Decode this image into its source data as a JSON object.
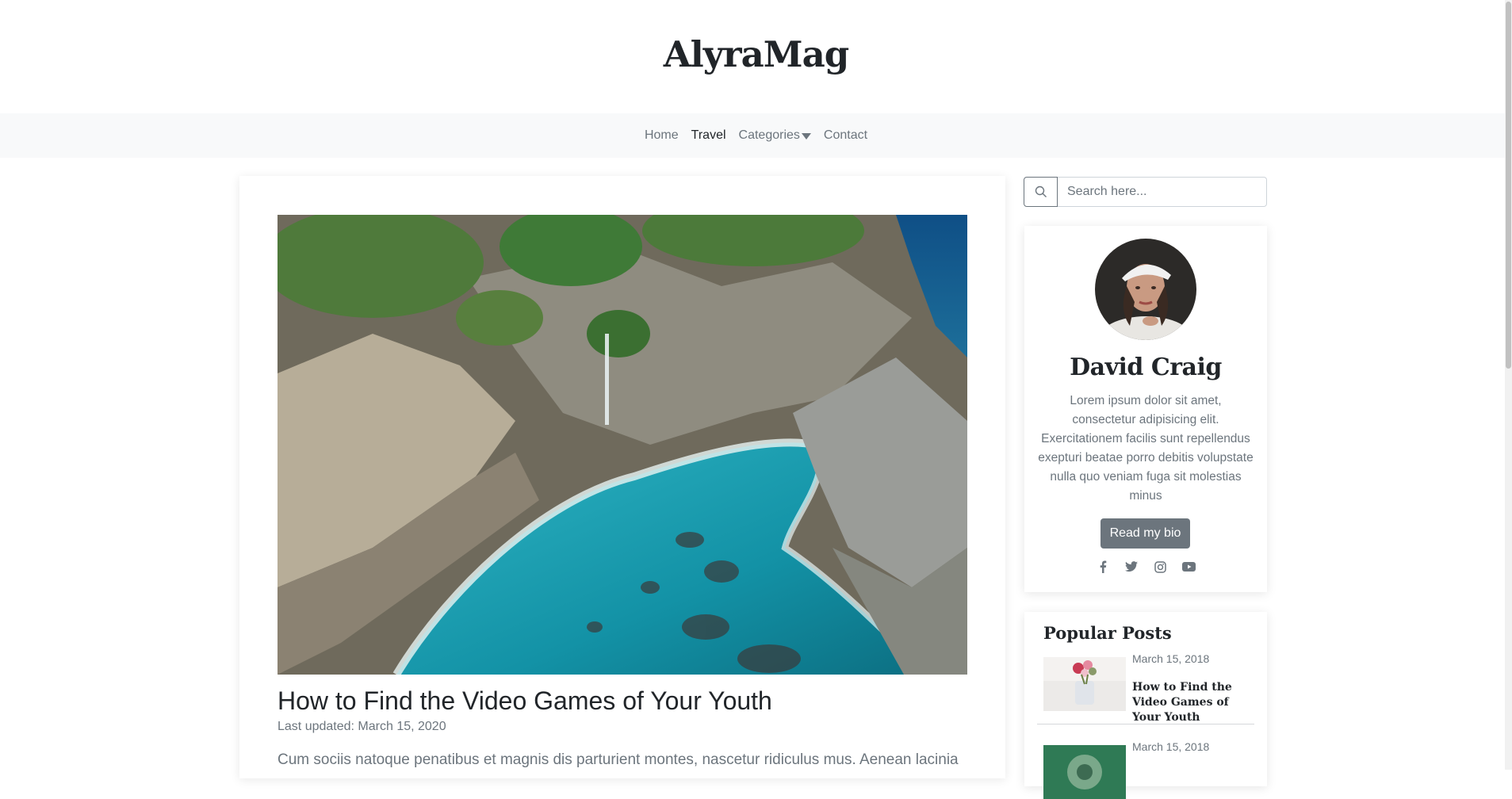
{
  "site": {
    "brand": "AlyraMag"
  },
  "nav": {
    "items": [
      {
        "label": "Home"
      },
      {
        "label": "Travel"
      },
      {
        "label": "Categories"
      },
      {
        "label": "Contact"
      }
    ]
  },
  "post": {
    "title": "How to Find the Video Games of Your Youth",
    "updated": "Last updated: March 15, 2020",
    "excerpt": "Cum sociis natoque penatibus et magnis dis parturient montes, nascetur ridiculus mus. Aenean lacinia"
  },
  "search": {
    "placeholder": "Search here..."
  },
  "bio": {
    "name": "David Craig",
    "text": "Lorem ipsum dolor sit amet, consectetur adipisicing elit. Exercitationem facilis sunt repellendus exepturi beatae porro debitis volupstate nulla quo veniam fuga sit molestias minus",
    "button": "Read my bio",
    "socials": [
      "facebook-icon",
      "twitter-icon",
      "instagram-icon",
      "youtube-icon"
    ]
  },
  "popular": {
    "title": "Popular Posts",
    "items": [
      {
        "date": "March 15, 2018",
        "title": "How to Find the Video Games of Your Youth"
      },
      {
        "date": "March 15, 2018",
        "title": ""
      }
    ]
  },
  "colors": {
    "nav_bg": "#f8f9fa",
    "muted": "#6c757d",
    "button": "#6c757d"
  }
}
